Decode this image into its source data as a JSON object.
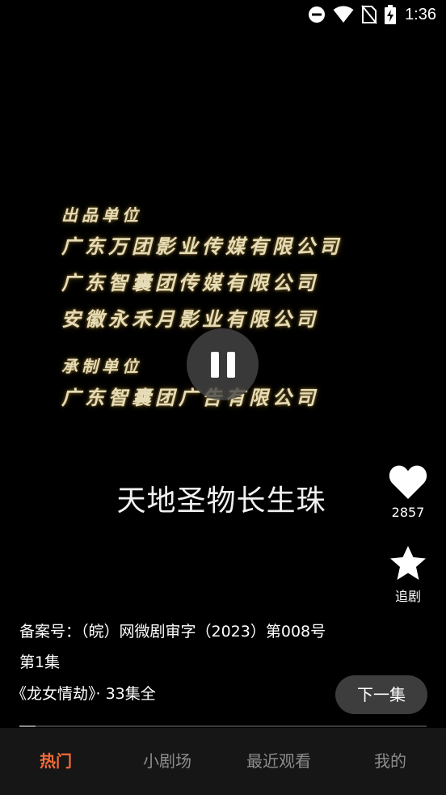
{
  "status_bar": {
    "time": "1:36",
    "icons": [
      "do-not-disturb-icon",
      "wifi-icon",
      "no-sim-icon",
      "battery-charging-icon"
    ]
  },
  "video": {
    "credits": {
      "producer_heading": "出品单位",
      "producers": [
        "广东万团影业传媒有限公司",
        "广东智囊团传媒有限公司",
        "安徽永禾月影业有限公司"
      ],
      "maker_heading": "承制单位",
      "makers": [
        "广东智囊团广告有限公司"
      ]
    },
    "title": "天地圣物长生珠",
    "progress": 0.04
  },
  "actions": {
    "like_count": "2857",
    "follow_label": "追剧"
  },
  "info": {
    "record_number": "备案号：（皖）网微剧审字（2023）第008号",
    "episode": "第1集",
    "series": "《龙女情劫》· 33集全",
    "next_label": "下一集"
  },
  "nav": {
    "tabs": [
      {
        "label": "热门",
        "active": true
      },
      {
        "label": "小剧场",
        "active": false
      },
      {
        "label": "最近观看",
        "active": false
      },
      {
        "label": "我的",
        "active": false
      }
    ]
  },
  "colors": {
    "accent": "#f26b3a",
    "background": "#000000",
    "nav_background": "#161616"
  }
}
